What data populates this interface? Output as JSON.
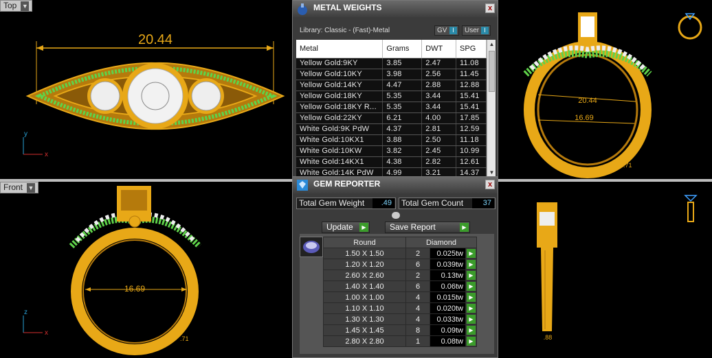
{
  "viewports": {
    "top": {
      "label": "Top",
      "dimension": "20.44",
      "axis_y": "y",
      "axis_x": "x"
    },
    "front": {
      "label": "Front",
      "dimension": "16.69",
      "small_dim": ".71",
      "axis_y": "z",
      "axis_x": "x"
    },
    "persp": {
      "dim_a": "20.44",
      "dim_b": "16.69",
      "dim_c": ".71"
    },
    "side": {
      "dim": ".88"
    }
  },
  "metal_weights": {
    "title": "METAL WEIGHTS",
    "library": "Library: Classic - (Fast)-Metal",
    "gv_label": "GV",
    "user_label": "User",
    "close": "x",
    "columns": [
      "Metal",
      "Grams",
      "DWT",
      "SPG"
    ],
    "rows": [
      [
        "Yellow Gold:9KY",
        "3.85",
        "2.47",
        "11.08"
      ],
      [
        "Yellow Gold:10KY",
        "3.98",
        "2.56",
        "11.45"
      ],
      [
        "Yellow Gold:14KY",
        "4.47",
        "2.88",
        "12.88"
      ],
      [
        "Yellow Gold:18KY",
        "5.35",
        "3.44",
        "15.41"
      ],
      [
        "Yellow Gold:18KY R...",
        "5.35",
        "3.44",
        "15.41"
      ],
      [
        "Yellow Gold:22KY",
        "6.21",
        "4.00",
        "17.85"
      ],
      [
        "White Gold:9K PdW",
        "4.37",
        "2.81",
        "12.59"
      ],
      [
        "White Gold:10KX1",
        "3.88",
        "2.50",
        "11.18"
      ],
      [
        "White Gold:10KW",
        "3.82",
        "2.45",
        "10.99"
      ],
      [
        "White Gold:14KX1",
        "4.38",
        "2.82",
        "12.61"
      ],
      [
        "White Gold:14K PdW",
        "4.99",
        "3.21",
        "14.37"
      ]
    ]
  },
  "gem_reporter": {
    "title": "GEM REPORTER",
    "close": "x",
    "total_weight_label": "Total Gem Weight",
    "total_weight_value": ".49",
    "total_count_label": "Total Gem Count",
    "total_count_value": "37",
    "update_label": "Update",
    "save_label": "Save Report",
    "col_shape": "Round",
    "col_material": "Diamond",
    "rows": [
      [
        "1.50 X 1.50",
        "2",
        "0.025tw"
      ],
      [
        "1.20 X 1.20",
        "6",
        "0.039tw"
      ],
      [
        "2.60 X 2.60",
        "2",
        "0.13tw"
      ],
      [
        "1.40 X 1.40",
        "6",
        "0.06tw"
      ],
      [
        "1.00 X 1.00",
        "4",
        "0.015tw"
      ],
      [
        "1.10 X 1.10",
        "4",
        "0.020tw"
      ],
      [
        "1.30 X 1.30",
        "4",
        "0.033tw"
      ],
      [
        "1.45 X 1.45",
        "8",
        "0.09tw"
      ],
      [
        "2.80 X 2.80",
        "1",
        "0.08tw"
      ]
    ]
  },
  "colors": {
    "gold": "#e8a817",
    "green": "#5fd34a",
    "white": "#eeeeee",
    "panel": "#3b3b3b"
  }
}
